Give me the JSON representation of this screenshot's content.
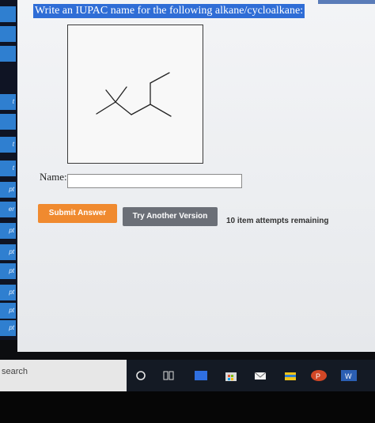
{
  "sidebar": {
    "items": [
      "",
      "",
      "",
      "t",
      "",
      "t",
      "t",
      "pt",
      "er",
      "pt",
      "pt",
      "pt",
      "pt",
      "pt",
      "pt"
    ]
  },
  "question": {
    "prompt": "Write an IUPAC name for the following alkane/cycloalkane:",
    "name_label": "Name:",
    "name_value": "",
    "submit_label": "Submit Answer",
    "try_label": "Try Another Version",
    "attempts_text": "10 item attempts remaining"
  },
  "taskbar": {
    "search_label": "search",
    "icons": [
      "cortana-circle-icon",
      "task-view-icon",
      "app-icon-blue",
      "store-icon",
      "mail-icon",
      "file-explorer-icon",
      "powerpoint-icon",
      "word-icon"
    ]
  },
  "colors": {
    "prompt_highlight": "#2f6dd6",
    "submit": "#f08a2f",
    "try_another": "#6b6f77",
    "sidebar_item": "#2f7fd0"
  }
}
